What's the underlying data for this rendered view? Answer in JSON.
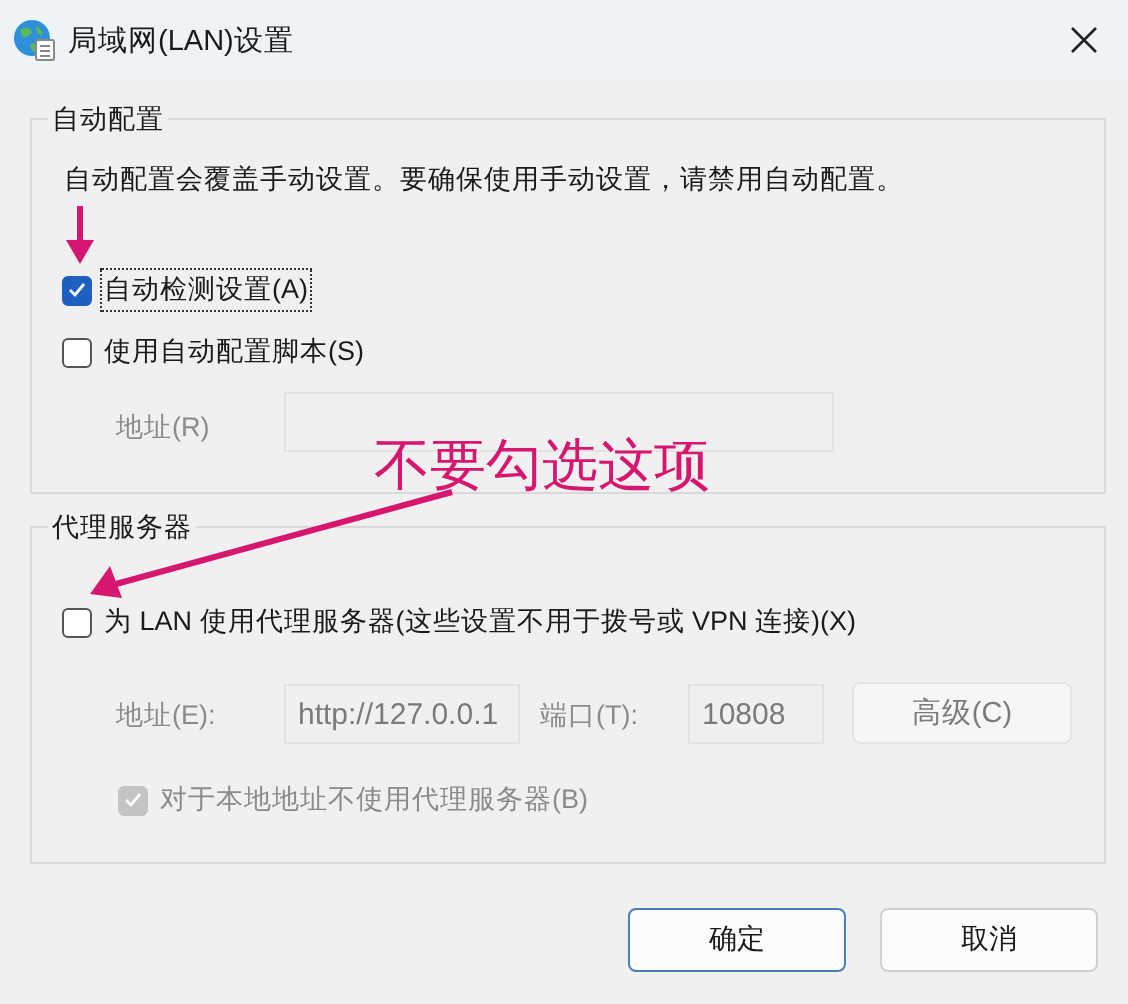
{
  "window": {
    "title": "局域网(LAN)设置"
  },
  "auto_config": {
    "title": "自动配置",
    "description": "自动配置会覆盖手动设置。要确保使用手动设置，请禁用自动配置。",
    "options": [
      {
        "label": "自动检测设置(A)",
        "checked": true,
        "focused": true
      },
      {
        "label": "使用自动配置脚本(S)",
        "checked": false,
        "focused": false
      }
    ],
    "address": {
      "label": "地址(R)",
      "disabled": true
    }
  },
  "proxy": {
    "title": "代理服务器",
    "use_proxy": {
      "label": "为 LAN 使用代理服务器(这些设置不用于拨号或 VPN 连接)(X)",
      "checked": false
    },
    "address": {
      "label": "地址(E):",
      "value": "http://127.0.0.1",
      "disabled": true
    },
    "port": {
      "label": "端口(T):",
      "value": "10808",
      "disabled": true
    },
    "advanced": {
      "label": "高级(C)",
      "disabled": true
    },
    "bypass_local": {
      "label": "对于本地地址不使用代理服务器(B)",
      "checked": true,
      "disabled": true
    }
  },
  "buttons": [
    {
      "label": "确定",
      "default": true
    },
    {
      "label": "取消",
      "default": false
    }
  ],
  "annotations": [
    {
      "kind": "arrow"
    },
    {
      "kind": "callout",
      "text": "不要勾选这项"
    }
  ]
}
